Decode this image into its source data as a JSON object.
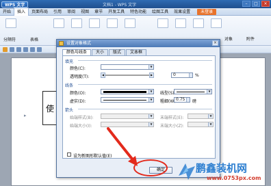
{
  "window": {
    "app_button": "WPS 文字",
    "doc_title": "文档1 - WPS 文字"
  },
  "menu": {
    "items": [
      "开始",
      "插入",
      "页面布局",
      "引用",
      "审阅",
      "视图",
      "章节",
      "开发工具",
      "特色功能",
      "绘图工具",
      "效果设置"
    ],
    "active_index": 1,
    "badge": "未登录"
  },
  "ribbon": {
    "left_label": "分隔符",
    "left_label2": "表格",
    "right_label1": "对象",
    "right_label2": "附件"
  },
  "document": {
    "shape_text": "使"
  },
  "dialog": {
    "title": "设置对象格式",
    "close_glyph": "×",
    "tabs": [
      "颜色与线条",
      "大小",
      "版式",
      "文本框"
    ],
    "active_tab": 0,
    "fill": {
      "section": "填充",
      "color_label": "颜色(C):",
      "transparency_label": "透明度(T):",
      "transparency_value": "0",
      "transparency_unit": "%"
    },
    "line": {
      "section": "线条",
      "color_label": "颜色(O):",
      "style_label": "线型(S):",
      "dash_label": "虚实(D):",
      "weight_label": "粗细(W):",
      "weight_value": "0.75",
      "weight_unit": "磅"
    },
    "arrows": {
      "section": "箭头",
      "begin_style_label": "始端样式(B):",
      "end_style_label": "末端样式(E):",
      "begin_size_label": "始端大小(I):",
      "end_size_label": "末端大小(Z):"
    },
    "default_checkbox_label": "设为新图形默认值(E)",
    "ok_button": "确定"
  },
  "watermark": {
    "title": "鹏鑫装机网",
    "url": "www.0753px.com"
  },
  "colors": {
    "titlebar": "#1f4f8e",
    "dialog_bg": "#e8eef7",
    "annotation_red": "#e32a1c",
    "watermark_blue": "#2e7fd0"
  }
}
